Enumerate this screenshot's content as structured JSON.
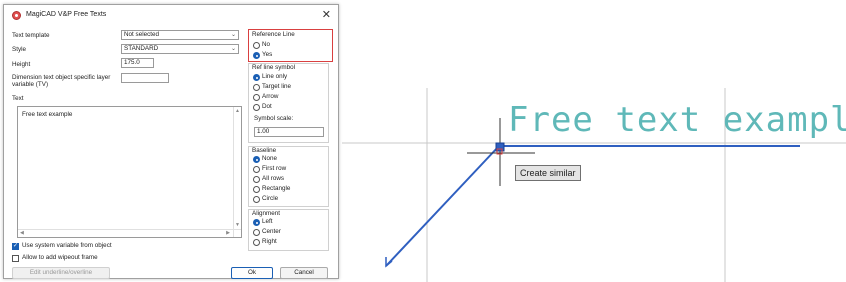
{
  "dialog": {
    "title": "MagiCAD V&P    Free Texts",
    "close_glyph": "✕",
    "text_template": {
      "label": "Text template",
      "value": "Not selected"
    },
    "style": {
      "label": "Style",
      "value": "STANDARD"
    },
    "height": {
      "label": "Height",
      "value": "175.0"
    },
    "dimension_var": {
      "label": "Dimension text object specific layer variable (TV)",
      "value": ""
    },
    "text": {
      "label": "Text",
      "value": "Free text example"
    },
    "use_system_variable": {
      "label": "Use system variable from object",
      "checked": true
    },
    "allow_wipeout": {
      "label": "Allow to add wipeout frame",
      "checked": false
    },
    "edit_underline_button": "Edit underline/overline",
    "ok_button": "Ok",
    "cancel_button": "Cancel",
    "reference_line": {
      "title": "Reference Line",
      "options": [
        {
          "label": "No",
          "selected": false
        },
        {
          "label": "Yes",
          "selected": true
        }
      ]
    },
    "ref_line_symbol": {
      "title": "Ref line symbol",
      "options": [
        {
          "label": "Line only",
          "selected": true
        },
        {
          "label": "Target line",
          "selected": false
        },
        {
          "label": "Arrow",
          "selected": false
        },
        {
          "label": "Dot",
          "selected": false
        }
      ],
      "scale_label": "Symbol scale:",
      "scale_value": "1.00"
    },
    "baseline": {
      "title": "Baseline",
      "options": [
        {
          "label": "None",
          "selected": true
        },
        {
          "label": "First row",
          "selected": false
        },
        {
          "label": "All rows",
          "selected": false
        },
        {
          "label": "Rectangle",
          "selected": false
        },
        {
          "label": "Circle",
          "selected": false
        }
      ]
    },
    "alignment": {
      "title": "Alignment",
      "options": [
        {
          "label": "Left",
          "selected": true
        },
        {
          "label": "Center",
          "selected": false
        },
        {
          "label": "Right",
          "selected": false
        }
      ]
    }
  },
  "canvas": {
    "text_preview": "Free text example",
    "tooltip": "Create similar",
    "colors": {
      "grid": "#c8c8c8",
      "leader": "#2f5fc0",
      "text": "#5fb8b8",
      "crosshair": "#333333",
      "highlight": "#d94040"
    }
  }
}
